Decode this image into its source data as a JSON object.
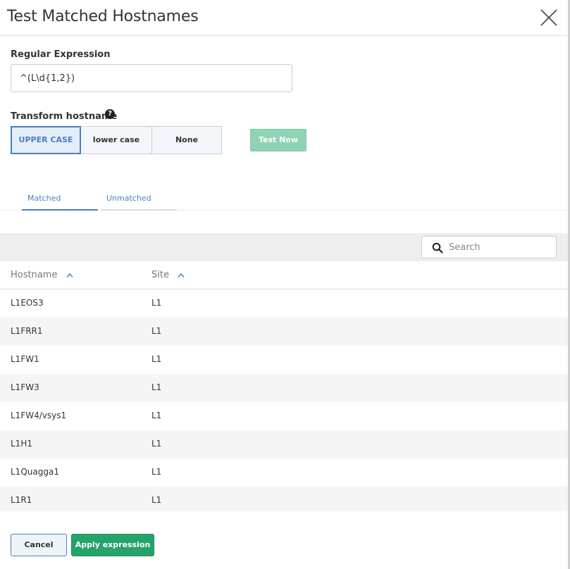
{
  "dialog": {
    "title": "Test Matched Hostnames"
  },
  "form": {
    "regex_label": "Regular Expression",
    "regex_value": "^(L\\d{1,2})",
    "transform_label": "Transform hostname",
    "help_glyph": "?",
    "transform_options": [
      "UPPER CASE",
      "lower case",
      "None"
    ],
    "transform_selected": "UPPER CASE",
    "test_button": "Test Now"
  },
  "tabs": [
    {
      "label": "Matched",
      "active": true
    },
    {
      "label": "Unmatched",
      "active": false
    }
  ],
  "search": {
    "placeholder": "Search",
    "value": ""
  },
  "table": {
    "columns": [
      "Hostname",
      "Site"
    ],
    "rows": [
      [
        "L1EOS3",
        "L1"
      ],
      [
        "L1FRR1",
        "L1"
      ],
      [
        "L1FW1",
        "L1"
      ],
      [
        "L1FW3",
        "L1"
      ],
      [
        "L1FW4/vsys1",
        "L1"
      ],
      [
        "L1H1",
        "L1"
      ],
      [
        "L1Quagga1",
        "L1"
      ],
      [
        "L1R1",
        "L1"
      ]
    ]
  },
  "footer": {
    "cancel": "Cancel",
    "apply": "Apply expression"
  },
  "colors": {
    "accent": "#4a7fc1",
    "primary_green": "#25a36a",
    "disabled_green": "#8fd3b5"
  },
  "icons": {
    "close": "close-icon",
    "help": "help-icon",
    "search": "search-icon",
    "sort": "sort-up-icon"
  }
}
